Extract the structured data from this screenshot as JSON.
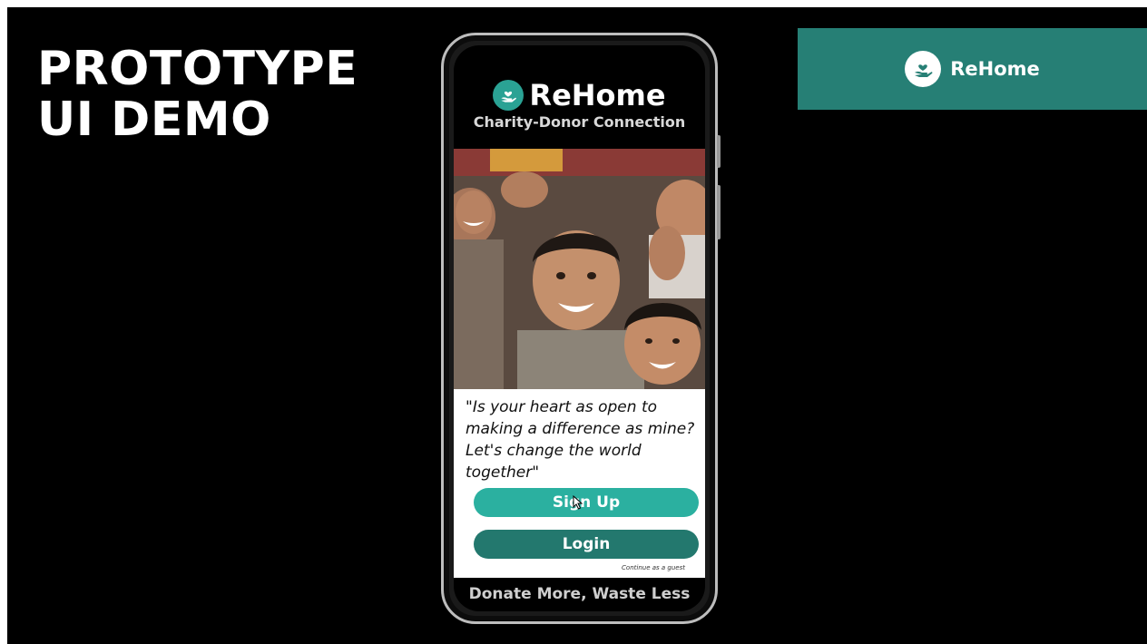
{
  "slide": {
    "title_line1": "PROTOTYPE",
    "title_line2": "UI DEMO"
  },
  "banner": {
    "brand": "ReHome",
    "logo_icon": "hand-heart-icon",
    "background": "#267f75"
  },
  "app": {
    "name": "ReHome",
    "tagline": "Charity-Donor Connection",
    "logo_icon": "hand-heart-icon",
    "hero_image": "children-smiling-photo",
    "quote": "\"Is your heart as open to making a difference as mine? Let's change the world together\"",
    "signup_label": "Sign Up",
    "login_label": "Login",
    "guest_label": "Continue as a guest",
    "footer": "Donate More, Waste Less",
    "colors": {
      "accent": "#2bb0a0",
      "accent_dark": "#23786e"
    }
  }
}
